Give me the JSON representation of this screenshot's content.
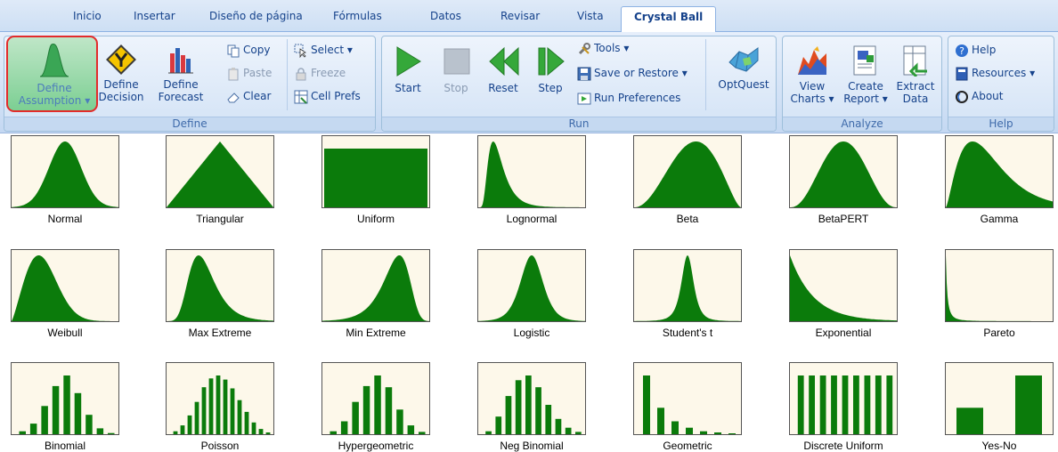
{
  "tabs": [
    {
      "label": "Inicio",
      "active": false
    },
    {
      "label": "Insertar",
      "active": false
    },
    {
      "label": "Diseño de página",
      "active": false
    },
    {
      "label": "Fórmulas",
      "active": false
    },
    {
      "label": "Datos",
      "active": false
    },
    {
      "label": "Revisar",
      "active": false
    },
    {
      "label": "Vista",
      "active": false
    },
    {
      "label": "Crystal Ball",
      "active": true
    }
  ],
  "ribbon": {
    "define": {
      "group_label": "Define",
      "define_assumption": [
        "Define",
        "Assumption ▾"
      ],
      "define_decision": [
        "Define",
        "Decision"
      ],
      "define_forecast": [
        "Define",
        "Forecast"
      ],
      "copy": "Copy",
      "paste": "Paste",
      "clear": "Clear",
      "select": "Select ▾",
      "freeze": "Freeze",
      "cell_prefs": "Cell Prefs"
    },
    "run": {
      "group_label": "Run",
      "start": "Start",
      "stop": "Stop",
      "reset": "Reset",
      "step": "Step",
      "tools": "Tools ▾",
      "save_restore": "Save or Restore ▾",
      "run_preferences": "Run Preferences",
      "optquest": "OptQuest"
    },
    "analyze": {
      "group_label": "Analyze",
      "view_charts": [
        "View",
        "Charts ▾"
      ],
      "create_report": [
        "Create",
        "Report ▾"
      ],
      "extract_data": [
        "Extract",
        "Data"
      ]
    },
    "help": {
      "group_label": "Help",
      "help": "Help",
      "resources": "Resources ▾",
      "about": "About"
    }
  },
  "colors": {
    "distribution_fill": "#0b7b0b",
    "thumbnail_background": "#fdf8ea",
    "ribbon_text": "#15428b",
    "selection_outline": "#e32b2b"
  },
  "distributions": [
    {
      "name": "Normal",
      "kind": "continuous"
    },
    {
      "name": "Triangular",
      "kind": "continuous"
    },
    {
      "name": "Uniform",
      "kind": "continuous"
    },
    {
      "name": "Lognormal",
      "kind": "continuous"
    },
    {
      "name": "Beta",
      "kind": "continuous"
    },
    {
      "name": "BetaPERT",
      "kind": "continuous"
    },
    {
      "name": "Gamma",
      "kind": "continuous"
    },
    {
      "name": "Weibull",
      "kind": "continuous"
    },
    {
      "name": "Max Extreme",
      "kind": "continuous"
    },
    {
      "name": "Min Extreme",
      "kind": "continuous"
    },
    {
      "name": "Logistic",
      "kind": "continuous"
    },
    {
      "name": "Student's t",
      "kind": "continuous"
    },
    {
      "name": "Exponential",
      "kind": "continuous"
    },
    {
      "name": "Pareto",
      "kind": "continuous"
    },
    {
      "name": "Binomial",
      "kind": "discrete"
    },
    {
      "name": "Poisson",
      "kind": "discrete"
    },
    {
      "name": "Hypergeometric",
      "kind": "discrete"
    },
    {
      "name": "Neg Binomial",
      "kind": "discrete"
    },
    {
      "name": "Geometric",
      "kind": "discrete"
    },
    {
      "name": "Discrete Uniform",
      "kind": "discrete"
    },
    {
      "name": "Yes-No",
      "kind": "discrete"
    }
  ]
}
